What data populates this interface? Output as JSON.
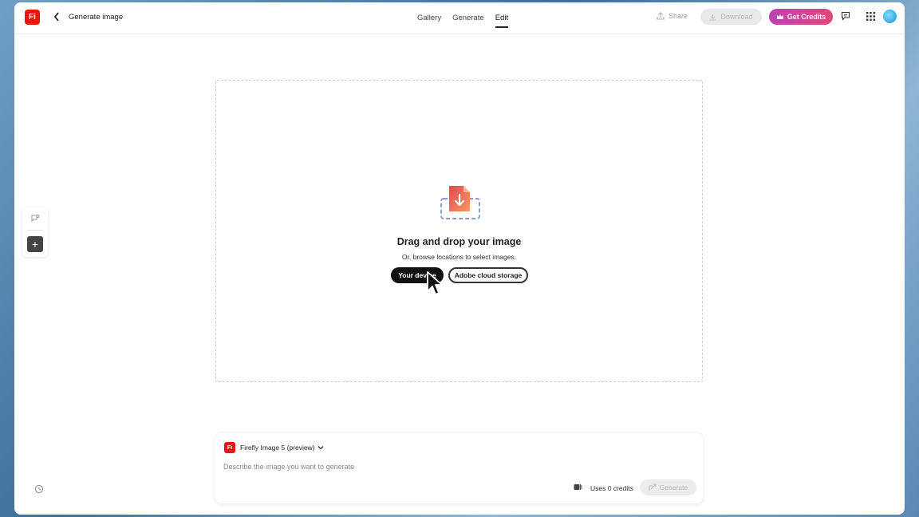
{
  "header": {
    "logo_text": "Fi",
    "page_title": "Generate image",
    "tabs": [
      {
        "label": "Gallery"
      },
      {
        "label": "Generate"
      },
      {
        "label": "Edit"
      }
    ],
    "share_label": "Share",
    "download_label": "Download",
    "credits_label": "Get Credits"
  },
  "dropzone": {
    "title": "Drag and drop your image",
    "subtitle": "Or, browse locations to select images.",
    "device_button": "Your device",
    "cloud_button": "Adobe cloud storage"
  },
  "prompt": {
    "model_logo_text": "Fi",
    "model_name": "Firefly Image 5 (preview)",
    "placeholder": "Describe the image you want to generate",
    "uses_credits": "Uses 0 credits",
    "generate_label": "Generate"
  },
  "colors": {
    "brand_red": "#e8160b",
    "credits_gradient_start": "#c13fb5",
    "credits_gradient_end": "#e0487a"
  },
  "icons": [
    "back-chevron-icon",
    "share-icon",
    "download-icon",
    "crown-icon",
    "chat-icon",
    "apps-grid-icon",
    "upload-file-icon",
    "cursor-icon",
    "style-icon",
    "add-icon",
    "history-icon",
    "chevron-down-icon",
    "credits-icon",
    "generate-icon"
  ]
}
